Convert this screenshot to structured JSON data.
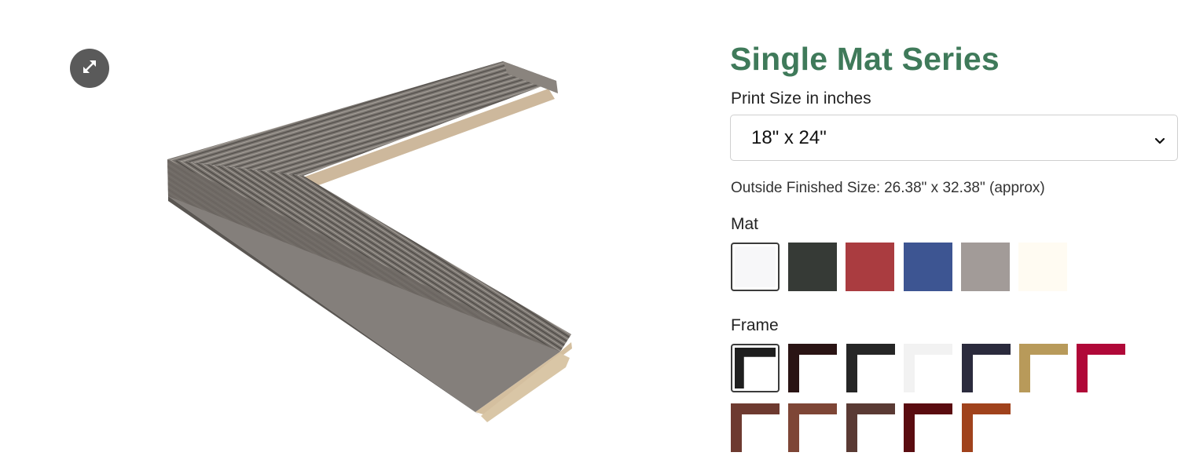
{
  "gallery": {
    "expand_icon": "expand-arrows-icon",
    "image_alt": "weathered gray wood frame corner sample"
  },
  "product": {
    "title": "Single Mat Series",
    "print_size": {
      "label": "Print Size in inches",
      "selected": "18\" x 24\""
    },
    "finished_size": {
      "prefix": "Outside Finished Size:",
      "value": "26.38\" x 32.38\" (approx)"
    }
  },
  "mat": {
    "label": "Mat",
    "swatches": [
      {
        "color": "#f7f7f9",
        "selected": true
      },
      {
        "color": "#363a36",
        "selected": false
      },
      {
        "color": "#aa3c40",
        "selected": false
      },
      {
        "color": "#3d5592",
        "selected": false
      },
      {
        "color": "#a29b98",
        "selected": false
      },
      {
        "color": "#fffbf2",
        "selected": false
      }
    ]
  },
  "frame": {
    "label": "Frame",
    "swatches": [
      {
        "color": "#1e1e1e",
        "inner": "#ffffff",
        "selected": true
      },
      {
        "color": "#2a1414",
        "inner": "#ffffff",
        "selected": false
      },
      {
        "color": "#262626",
        "inner": "#ffffff",
        "selected": false
      },
      {
        "color": "#f2f2f2",
        "inner": "#ffffff",
        "selected": false
      },
      {
        "color": "#2b2b3d",
        "inner": "#ffffff",
        "selected": false
      },
      {
        "color": "#b89a5a",
        "inner": "#ffffff",
        "selected": false
      },
      {
        "color": "#b00838",
        "inner": "#ffffff",
        "selected": false
      },
      {
        "color": "#6e3a30",
        "inner": "#ffffff",
        "selected": false
      },
      {
        "color": "#7e4636",
        "inner": "#ffffff",
        "selected": false
      },
      {
        "color": "#5a3a34",
        "inner": "#ffffff",
        "selected": false
      },
      {
        "color": "#5a0c10",
        "inner": "#ffffff",
        "selected": false
      },
      {
        "color": "#a0421c",
        "inner": "#ffffff",
        "selected": false
      }
    ]
  }
}
